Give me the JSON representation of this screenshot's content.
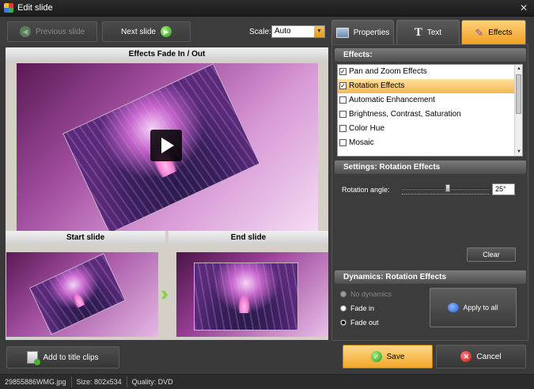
{
  "window": {
    "title": "Edit slide",
    "close_glyph": "✕"
  },
  "nav": {
    "prev_label": "Previous slide",
    "next_label": "Next slide",
    "scale_label": "Scale:",
    "scale_value": "Auto"
  },
  "preview": {
    "header": "Effects Fade In / Out",
    "start_label": "Start slide",
    "end_label": "End slide",
    "transition_glyph": "›››"
  },
  "tabs": [
    {
      "label": "Properties",
      "icon": "properties-icon"
    },
    {
      "label": "Text",
      "icon": "text-icon"
    },
    {
      "label": "Effects",
      "icon": "effects-icon",
      "active": true
    }
  ],
  "effects": {
    "header": "Effects:",
    "items": [
      {
        "label": "Pan and Zoom Effects",
        "checked": true
      },
      {
        "label": "Rotation Effects",
        "checked": true,
        "selected": true
      },
      {
        "label": "Automatic Enhancement",
        "checked": false
      },
      {
        "label": "Brightness, Contrast, Saturation",
        "checked": false
      },
      {
        "label": "Color Hue",
        "checked": false
      },
      {
        "label": "Mosaic",
        "checked": false
      }
    ]
  },
  "settings": {
    "header": "Settings: Rotation Effects",
    "angle_label": "Rotation angle:",
    "angle_value": "25°",
    "clear_label": "Clear"
  },
  "dynamics": {
    "header": "Dynamics: Rotation Effects",
    "options": [
      {
        "label": "No dynamics",
        "disabled": true
      },
      {
        "label": "Fade in"
      },
      {
        "label": "Fade out",
        "checked": true
      }
    ],
    "apply_label": "Apply to all"
  },
  "bottom": {
    "add_title_label": "Add to title clips",
    "save_label": "Save",
    "cancel_label": "Cancel"
  },
  "status": {
    "file": "29855886WMG.jpg",
    "size": "Size: 802x534",
    "quality": "Quality: DVD"
  },
  "colors": {
    "accent": "#f0a020",
    "selection": "#f5b850",
    "background": "#3a3a3a"
  }
}
